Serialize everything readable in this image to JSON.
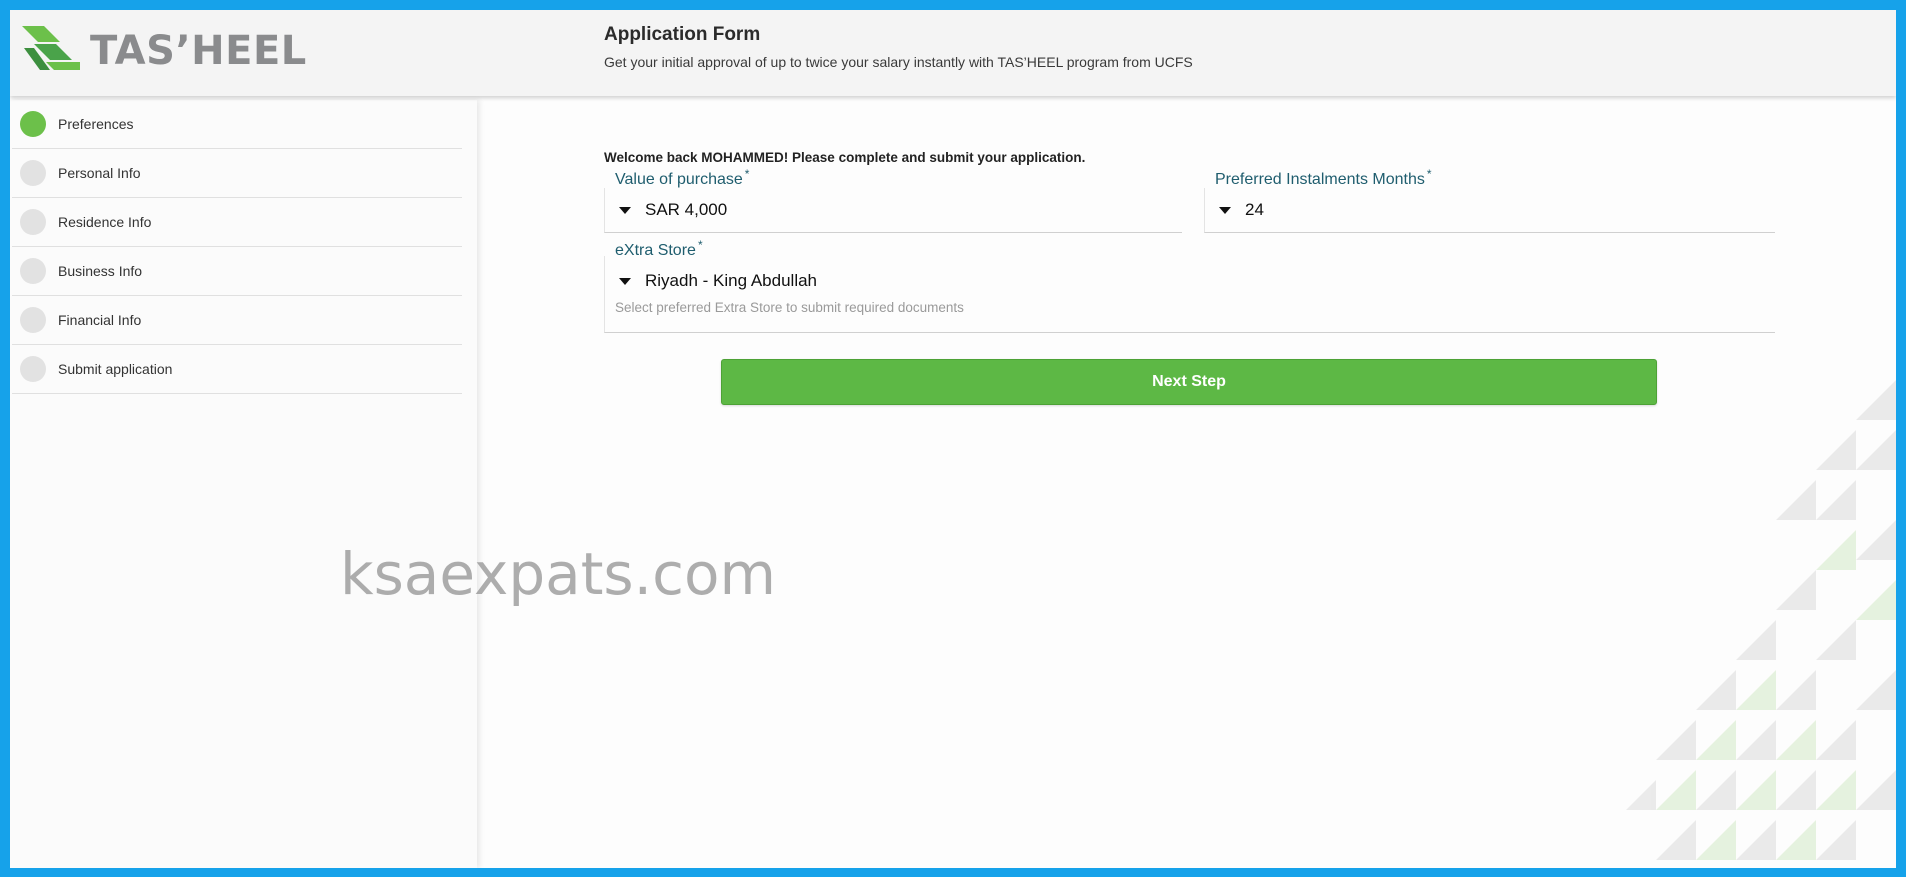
{
  "header": {
    "logo_text": "TAS’HEEL",
    "title": "Application Form",
    "subtitle": "Get your initial approval of up to twice your salary instantly with TAS’HEEL program from UCFS"
  },
  "sidebar": {
    "steps": [
      {
        "label": "Preferences",
        "active": true
      },
      {
        "label": "Personal Info",
        "active": false
      },
      {
        "label": "Residence Info",
        "active": false
      },
      {
        "label": "Business Info",
        "active": false
      },
      {
        "label": "Financial Info",
        "active": false
      },
      {
        "label": "Submit application",
        "active": false
      }
    ]
  },
  "form": {
    "welcome": "Welcome back MOHAMMED! Please complete and submit your application.",
    "value_of_purchase": {
      "label": "Value of purchase",
      "required_mark": "*",
      "value": "SAR 4,000"
    },
    "instalments": {
      "label": "Preferred Instalments Months",
      "required_mark": "*",
      "value": "24"
    },
    "store": {
      "label": "eXtra Store",
      "required_mark": "*",
      "value": "Riyadh - King Abdullah",
      "helper": "Select preferred Extra Store to submit required documents"
    },
    "next_button": "Next Step"
  },
  "watermark": "ksaexpats.com",
  "colors": {
    "border_blue": "#16a2ea",
    "accent_green": "#5db845",
    "label_teal": "#1f5d6e",
    "logo_gray": "#8a8b8d"
  }
}
